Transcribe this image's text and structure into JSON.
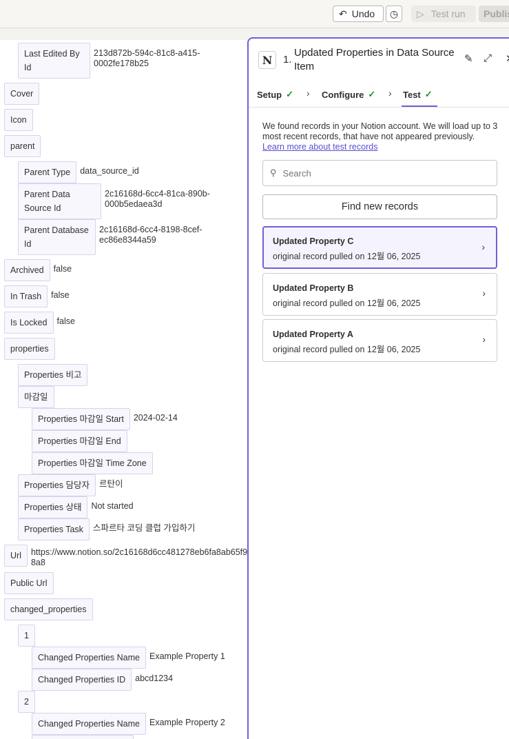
{
  "topbar": {
    "undo_label": "Undo",
    "test_run_label": "Test run",
    "publish_label": "Publis"
  },
  "data_tree": {
    "last_edited_by_id": {
      "key": "Last Edited By Id",
      "value": "213d872b-594c-81c8-a415-0002fe178b25"
    },
    "cover": "Cover",
    "icon": "Icon",
    "parent": "parent",
    "parent_type": {
      "key": "Parent Type",
      "value": "data_source_id"
    },
    "parent_data_source_id": {
      "key": "Parent Data Source Id",
      "value": "2c16168d-6cc4-81ca-890b-000b5edaea3d"
    },
    "parent_database_id": {
      "key": "Parent Database Id",
      "value": "2c16168d-6cc4-8198-8cef-ec86e8344a59"
    },
    "archived": {
      "key": "Archived",
      "value": "false"
    },
    "in_trash": {
      "key": "In Trash",
      "value": "false"
    },
    "is_locked": {
      "key": "Is Locked",
      "value": "false"
    },
    "properties": "properties",
    "prop_bigo": "Properties 비고",
    "prop_deadline": "마감일",
    "prop_deadline_start": {
      "key": "Properties 마감일 Start",
      "value": "2024-02-14"
    },
    "prop_deadline_end": "Properties 마감일 End",
    "prop_deadline_tz": "Properties 마감일 Time Zone",
    "prop_assignee": {
      "key": "Properties 담당자",
      "value": "르탄이"
    },
    "prop_status": {
      "key": "Properties 상태",
      "value": "Not started"
    },
    "prop_task": {
      "key": "Properties Task",
      "value": "스파르타 코딩 클럽 가입하기"
    },
    "url": {
      "key": "Url",
      "value": "https://www.notion.so/2c16168d6cc481278eb6fa8ab65f98a8"
    },
    "public_url": "Public Url",
    "changed_properties": "changed_properties",
    "cp1_index": "1",
    "cp1_name": {
      "key": "Changed Properties Name",
      "value": "Example Property 1"
    },
    "cp1_id": {
      "key": "Changed Properties ID",
      "value": "abcd1234"
    },
    "cp2_index": "2",
    "cp2_name": {
      "key": "Changed Properties Name",
      "value": "Example Property 2"
    }
  },
  "step_panel": {
    "app_icon": "notion-icon",
    "step_number": "1.",
    "step_title": "Updated Properties in Data Source Item",
    "tabs": [
      {
        "label": "Setup"
      },
      {
        "label": "Configure"
      },
      {
        "label": "Test"
      }
    ],
    "active_tab": "Test",
    "description": "We found records in your Notion account. We will load up to 3 most recent records, that have not appeared previously.",
    "learn_more_link": "Learn more about test records",
    "search_placeholder": "Search",
    "find_button_label": "Find new records",
    "records": [
      {
        "title": "Updated Property C",
        "subtitle": "original record pulled on 12월 06, 2025",
        "selected": true
      },
      {
        "title": "Updated Property B",
        "subtitle": "original record pulled on 12월 06, 2025",
        "selected": false
      },
      {
        "title": "Updated Property A",
        "subtitle": "original record pulled on 12월 06, 2025",
        "selected": false
      }
    ]
  },
  "colors": {
    "accent": "#6c61d9",
    "success": "#1e8f3e",
    "key_border": "#d6d4ec"
  }
}
